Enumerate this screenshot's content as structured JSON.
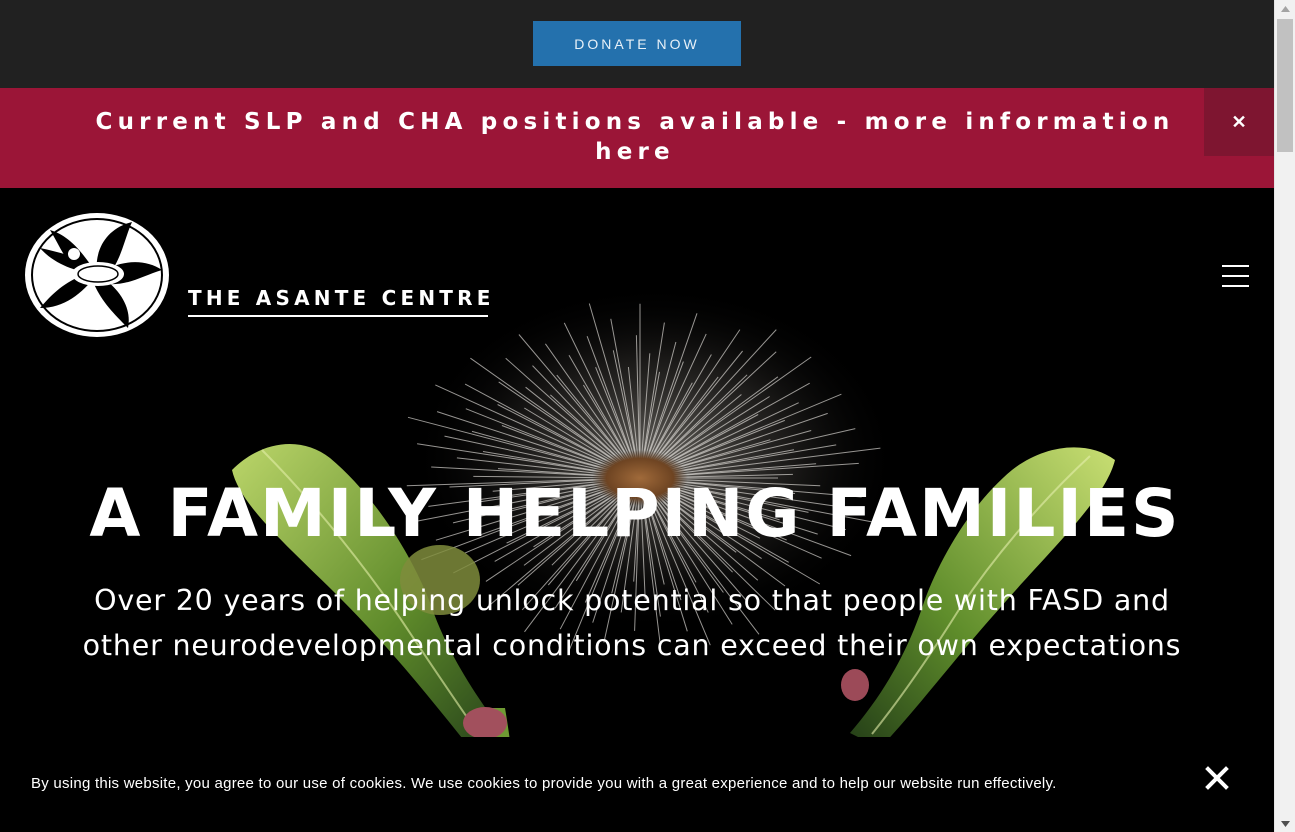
{
  "donate": {
    "label": "DONATE NOW"
  },
  "alert": {
    "text": "Current SLP and CHA positions available - more information here",
    "close_glyph": "✕"
  },
  "logo": {
    "text": "THE ASANTE CENTRE"
  },
  "hero": {
    "title": "A FAMILY HELPING FAMILIES",
    "subtitle": "Over 20 years of helping unlock potential so that people with FASD and other neurodevelopmental conditions can exceed their own expectations"
  },
  "cookie": {
    "text": "By using this website, you agree to our use of cookies. We use cookies to provide you with a great experience and to help our website run effectively."
  },
  "icons": {
    "menu": "hamburger-menu-icon",
    "cookie_close": "close-icon",
    "alert_close": "close-icon",
    "scroll_up": "chevron-up-icon",
    "scroll_down": "chevron-down-icon"
  },
  "colors": {
    "donate_bar": "#212121",
    "donate_button": "#2471ad",
    "alert_bar": "#9b1537",
    "alert_close_bg": "#7e1530",
    "hero_bg": "#000000",
    "text": "#ffffff"
  }
}
